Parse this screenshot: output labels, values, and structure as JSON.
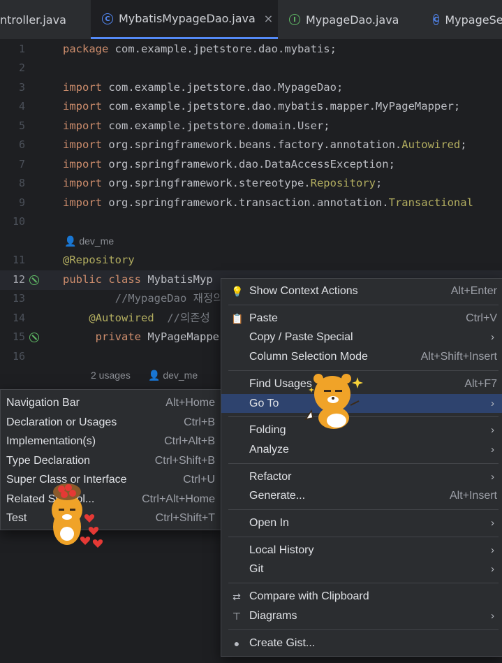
{
  "tabs": [
    {
      "label": "ntroller.java",
      "icon": ""
    },
    {
      "label": "MybatisMypageDao.java",
      "icon": "C",
      "close": "×"
    },
    {
      "label": "MypageDao.java",
      "icon": "I"
    },
    {
      "label": "MypageSe",
      "icon": "C"
    }
  ],
  "lines": [
    {
      "n": "1",
      "parts": [
        [
          "kw",
          "package "
        ],
        [
          "",
          "com.example.jpetstore.dao.mybatis;"
        ]
      ]
    },
    {
      "n": "2",
      "parts": []
    },
    {
      "n": "3",
      "parts": [
        [
          "kw",
          "import "
        ],
        [
          "",
          "com.example.jpetstore.dao.MypageDao;"
        ]
      ]
    },
    {
      "n": "4",
      "parts": [
        [
          "kw",
          "import "
        ],
        [
          "",
          "com.example.jpetstore.dao.mybatis.mapper.MyPageMapper;"
        ]
      ]
    },
    {
      "n": "5",
      "parts": [
        [
          "kw",
          "import "
        ],
        [
          "",
          "com.example.jpetstore.domain.User;"
        ]
      ]
    },
    {
      "n": "6",
      "parts": [
        [
          "kw",
          "import "
        ],
        [
          "",
          "org.springframework.beans.factory.annotation."
        ],
        [
          "ann",
          "Autowired"
        ],
        [
          "",
          ";"
        ]
      ]
    },
    {
      "n": "7",
      "parts": [
        [
          "kw",
          "import "
        ],
        [
          "",
          "org.springframework.dao.DataAccessException;"
        ]
      ]
    },
    {
      "n": "8",
      "parts": [
        [
          "kw",
          "import "
        ],
        [
          "",
          "org.springframework.stereotype."
        ],
        [
          "ann",
          "Repository"
        ],
        [
          "",
          ";"
        ]
      ]
    },
    {
      "n": "9",
      "parts": [
        [
          "kw",
          "import "
        ],
        [
          "",
          "org.springframework.transaction.annotation."
        ],
        [
          "ann",
          "Transactional"
        ]
      ]
    },
    {
      "n": "10",
      "parts": []
    },
    {
      "n": "11",
      "parts": [
        [
          "ann",
          "@Repository"
        ]
      ]
    },
    {
      "n": "12",
      "parts": [
        [
          "kw",
          "public class "
        ],
        [
          "",
          "MybatisMyp"
        ]
      ]
    },
    {
      "n": "13",
      "parts": [
        [
          "cmt",
          "        //MypageDao 재정의"
        ]
      ]
    },
    {
      "n": "14",
      "parts": [
        [
          "ann",
          "    @Autowired"
        ],
        [
          "cmt",
          "  //의존성"
        ]
      ]
    },
    {
      "n": "15",
      "parts": [
        [
          "kw",
          "     private "
        ],
        [
          "",
          "MyPageMappe"
        ]
      ]
    },
    {
      "n": "16",
      "parts": []
    }
  ],
  "hints": {
    "author1": "dev_me",
    "usages": "2 usages",
    "author2": "dev_me"
  },
  "context_menu": {
    "items": [
      {
        "label": "Show Context Actions",
        "shortcut": "Alt+Enter",
        "icon": "💡"
      },
      {
        "sep": true
      },
      {
        "label": "Paste",
        "shortcut": "Ctrl+V",
        "icon": "📋"
      },
      {
        "label": "Copy / Paste Special",
        "arrow": true
      },
      {
        "label": "Column Selection Mode",
        "shortcut": "Alt+Shift+Insert"
      },
      {
        "sep": true
      },
      {
        "label": "Find Usages",
        "shortcut": "Alt+F7"
      },
      {
        "label": "Go To",
        "arrow": true,
        "selected": true
      },
      {
        "sep": true
      },
      {
        "label": "Folding",
        "arrow": true
      },
      {
        "label": "Analyze",
        "arrow": true
      },
      {
        "sep": true
      },
      {
        "label": "Refactor",
        "arrow": true
      },
      {
        "label": "Generate...",
        "shortcut": "Alt+Insert"
      },
      {
        "sep": true
      },
      {
        "label": "Open In",
        "arrow": true
      },
      {
        "sep": true
      },
      {
        "label": "Local History",
        "arrow": true
      },
      {
        "label": "Git",
        "arrow": true
      },
      {
        "sep": true
      },
      {
        "label": "Compare with Clipboard",
        "icon": "⇄"
      },
      {
        "label": "Diagrams",
        "arrow": true,
        "icon": "⊤"
      },
      {
        "sep": true
      },
      {
        "label": "Create Gist...",
        "icon": "●"
      }
    ]
  },
  "goto_submenu": {
    "items": [
      {
        "label": "Navigation Bar",
        "shortcut": "Alt+Home"
      },
      {
        "label": "Declaration or Usages",
        "shortcut": "Ctrl+B"
      },
      {
        "label": "Implementation(s)",
        "shortcut": "Ctrl+Alt+B"
      },
      {
        "label": "Type Declaration",
        "shortcut": "Ctrl+Shift+B"
      },
      {
        "label": "Super Class or Interface",
        "shortcut": "Ctrl+U"
      },
      {
        "label": "Related Symbol...",
        "shortcut": "Ctrl+Alt+Home"
      },
      {
        "label": "Test",
        "shortcut": "Ctrl+Shift+T"
      }
    ]
  },
  "arrow_glyph": "›"
}
